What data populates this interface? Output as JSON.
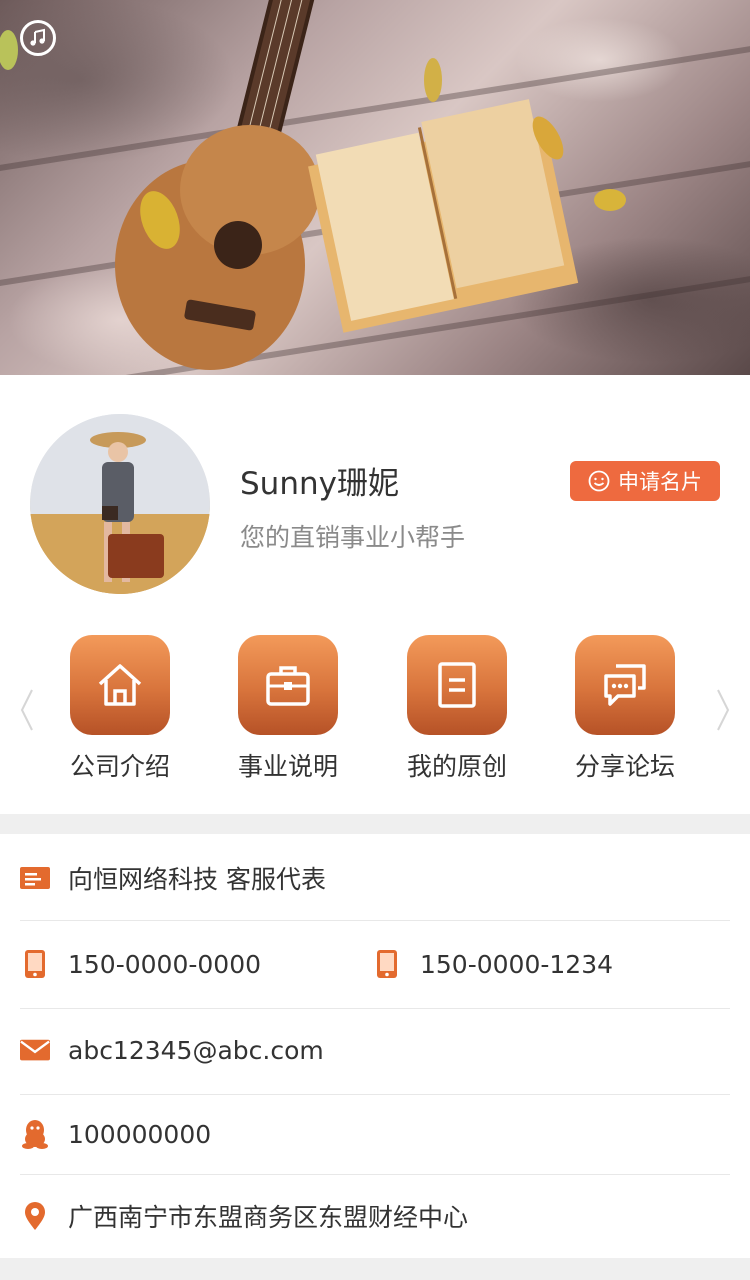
{
  "banner": {
    "music_icon": "music-note-icon"
  },
  "profile": {
    "name": "Sunny珊妮",
    "subtitle": "您的直销事业小帮手",
    "card_button_label": "申请名片",
    "card_button_icon": "smile-icon"
  },
  "nav": {
    "items": [
      {
        "label": "公司介绍",
        "icon": "home-icon"
      },
      {
        "label": "事业说明",
        "icon": "briefcase-icon"
      },
      {
        "label": "我的原创",
        "icon": "document-icon"
      },
      {
        "label": "分享论坛",
        "icon": "chat-icon"
      }
    ]
  },
  "info": {
    "company": "向恒网络科技 客服代表",
    "phone1": "150-0000-0000",
    "phone2": "150-0000-1234",
    "email": "abc12345@abc.com",
    "qq": "100000000",
    "address": "广西南宁市东盟商务区东盟财经中心"
  },
  "colors": {
    "accent": "#ee6a3f",
    "icon_gradient_top": "#f39a5a",
    "icon_gradient_bottom": "#b65227"
  }
}
